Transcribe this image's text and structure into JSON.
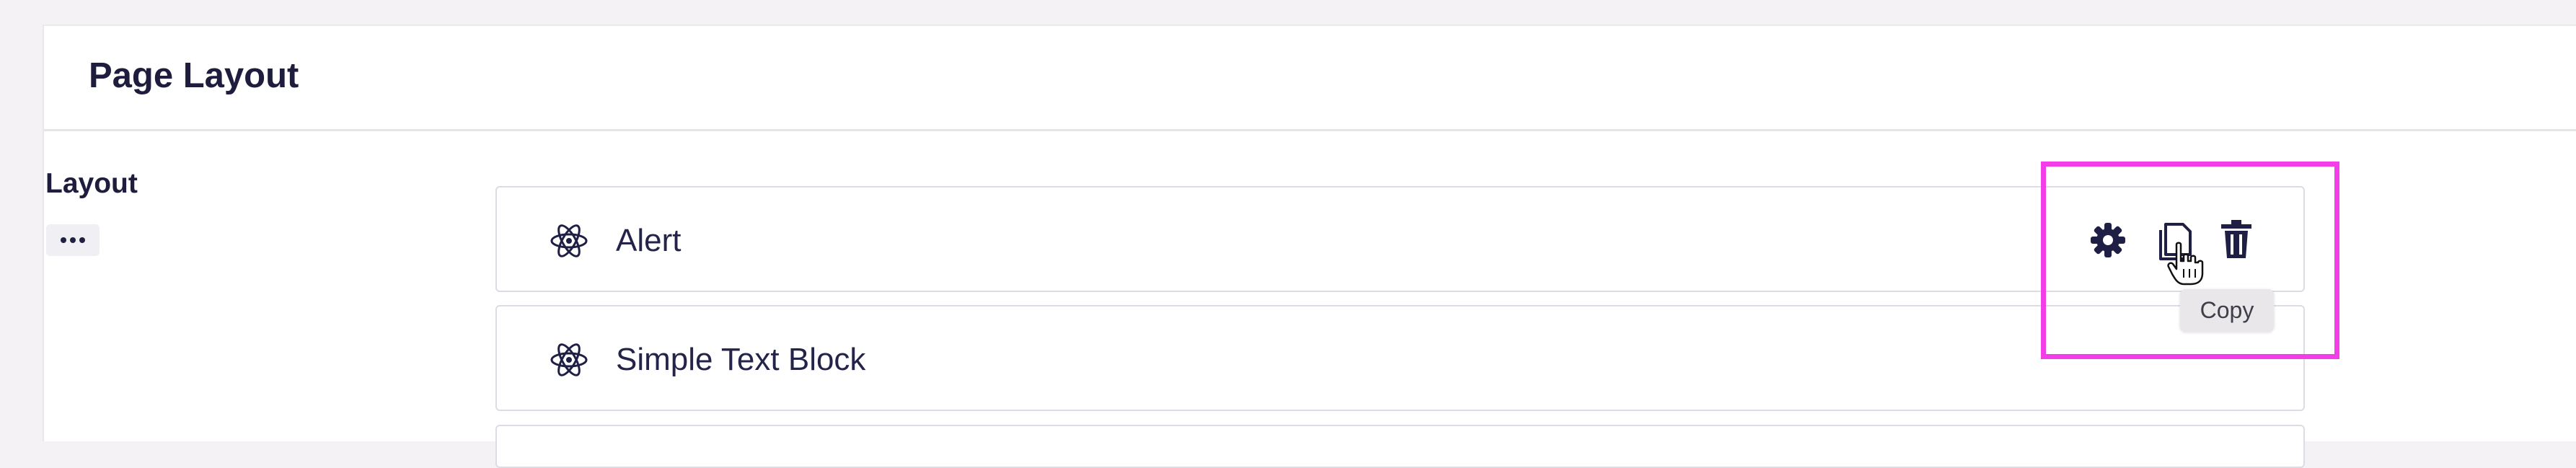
{
  "panel": {
    "title": "Page Layout"
  },
  "field": {
    "label": "Layout",
    "more_icon": "more-horizontal-icon"
  },
  "blocks": [
    {
      "label": "Alert",
      "icon": "atom-icon"
    },
    {
      "label": "Simple Text Block",
      "icon": "atom-icon"
    }
  ],
  "actions": {
    "settings_icon": "gear-icon",
    "copy_icon": "copy-icon",
    "delete_icon": "trash-icon"
  },
  "tooltip": {
    "text": "Copy"
  },
  "colors": {
    "highlight": "#f23de9",
    "text": "#1f1d3d",
    "icon": "#1f1f45"
  }
}
